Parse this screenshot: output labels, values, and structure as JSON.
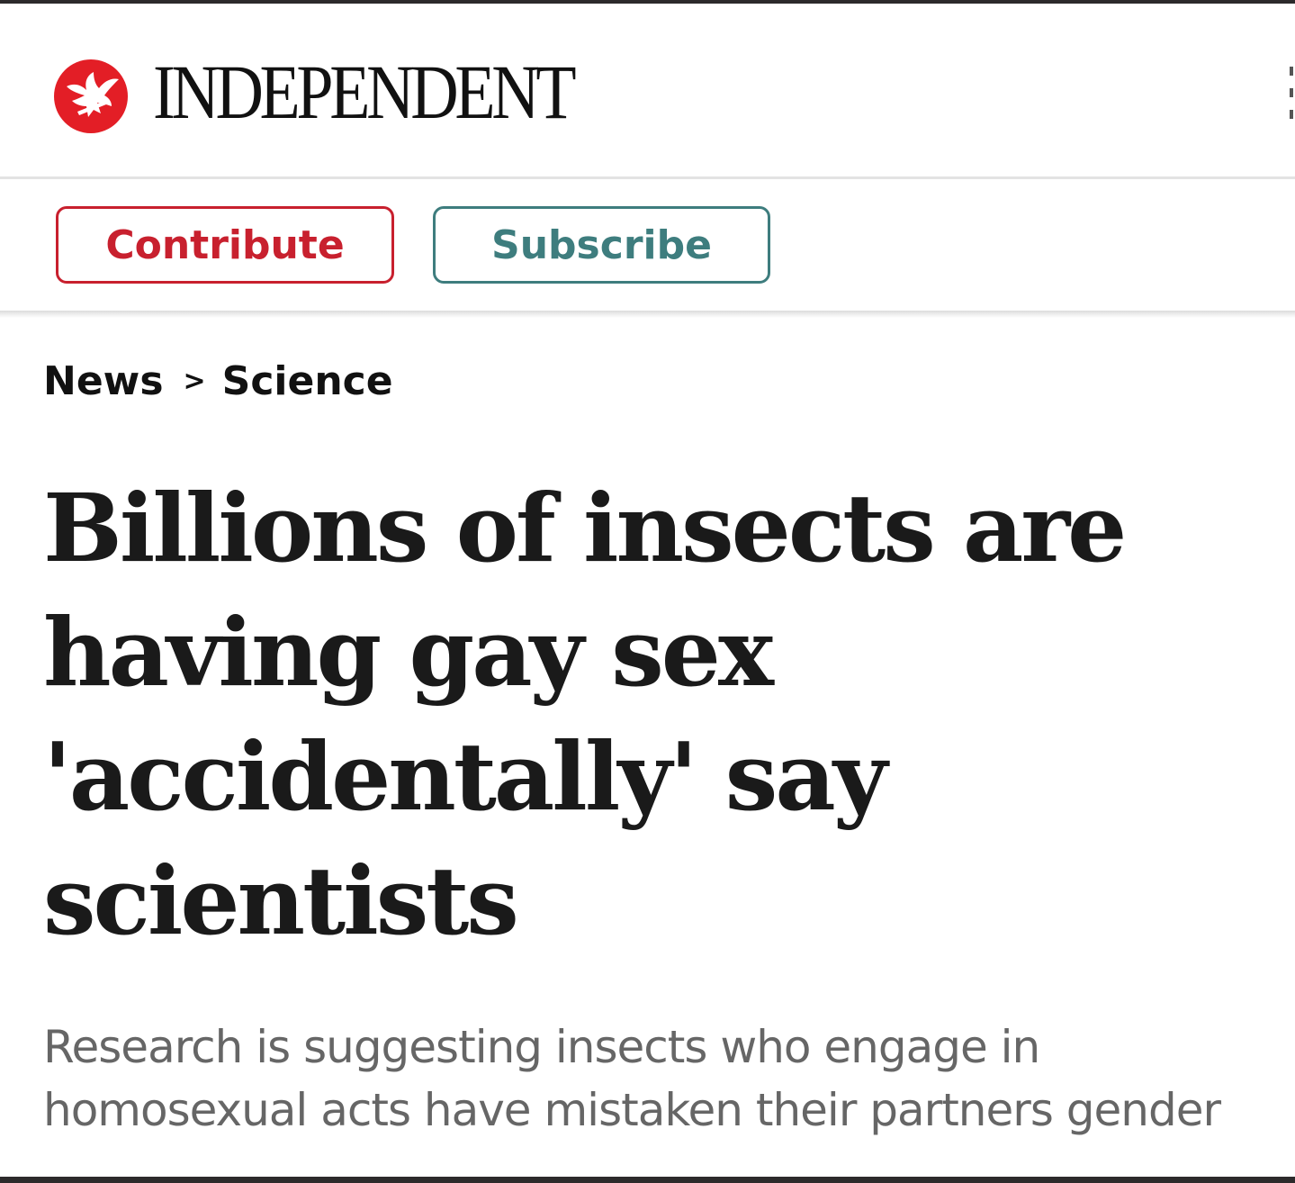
{
  "masthead": {
    "brand": "INDEPENDENT",
    "logo_icon": "eagle-icon",
    "logo_color": "#e31e26"
  },
  "actions": {
    "contribute_label": "Contribute",
    "contribute_color": "#c8202e",
    "subscribe_label": "Subscribe",
    "subscribe_color": "#3e7d7e"
  },
  "breadcrumb": {
    "section": "News",
    "separator": ">",
    "subsection": "Science"
  },
  "article": {
    "headline": "Billions of insects are having gay sex 'accidentally' say scientists",
    "standfirst": "Research is suggesting insects who engage in homosexual acts have mistaken their partners gender"
  }
}
